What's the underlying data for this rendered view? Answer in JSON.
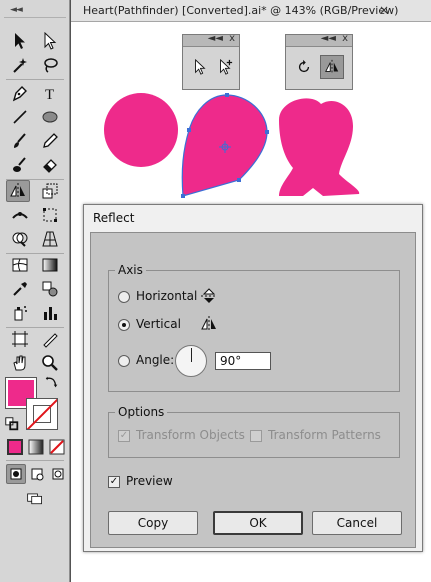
{
  "document": {
    "tab_title": "Heart(Pathfinder) [Converted].ai* @ 143% (RGB/Preview)",
    "close_glyph": "×"
  },
  "colors": {
    "fill": "#ee2a8b",
    "selection": "#3b6fd6"
  },
  "toolbar": {
    "grip": "◄◄",
    "tools": [
      "selection-tool",
      "direct-selection-tool",
      "magic-wand-tool",
      "lasso-tool",
      "pen-tool",
      "type-tool",
      "line-segment-tool",
      "ellipse-tool",
      "paintbrush-tool",
      "pencil-tool",
      "blob-brush-tool",
      "eraser-tool",
      "reflect-tool",
      "scale-tool",
      "width-tool",
      "free-transform-tool",
      "shape-builder-tool",
      "perspective-grid-tool",
      "mesh-tool",
      "gradient-tool",
      "eyedropper-tool",
      "blend-tool",
      "symbol-sprayer-tool",
      "column-graph-tool",
      "artboard-tool",
      "slice-tool",
      "hand-tool",
      "zoom-tool"
    ]
  },
  "floating_panels": {
    "left": {
      "collapse_glyph": "◄◄",
      "close_glyph": "x",
      "tools": [
        "selection-tool",
        "direct-selection-tool"
      ]
    },
    "right": {
      "collapse_glyph": "◄◄",
      "close_glyph": "x",
      "tools": [
        "rotate-tool",
        "reflect-tool"
      ]
    }
  },
  "dialog": {
    "title": "Reflect",
    "axis": {
      "legend": "Axis",
      "options": [
        {
          "label": "Horizontal",
          "selected": false
        },
        {
          "label": "Vertical",
          "selected": true
        },
        {
          "label": "Angle:",
          "selected": false
        }
      ],
      "angle_value": "90°"
    },
    "options": {
      "legend": "Options",
      "transform_objects": {
        "label": "Transform Objects",
        "checked": true,
        "enabled": false
      },
      "transform_patterns": {
        "label": "Transform Patterns",
        "checked": false,
        "enabled": false
      }
    },
    "preview": {
      "label": "Preview",
      "checked": true,
      "mark": "✓"
    },
    "buttons": {
      "copy": "Copy",
      "ok": "OK",
      "cancel": "Cancel"
    }
  }
}
